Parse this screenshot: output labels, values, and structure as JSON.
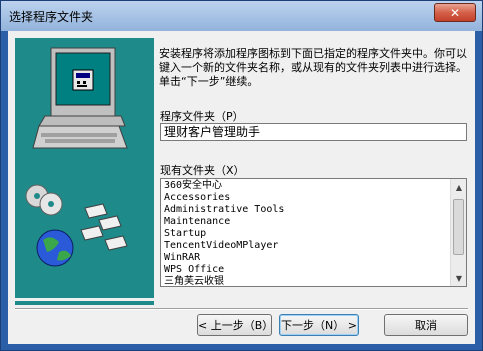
{
  "window": {
    "title": "选择程序文件夹",
    "close_label": "✕"
  },
  "instructions": "安装程序将添加程序图标到下面已指定的程序文件夹中。你可以键入一个新的文件夹名称，或从现有的文件夹列表中进行选择。单击“下一步”继续。",
  "program_folder": {
    "label": "程序文件夹（P）",
    "value": "理财客户管理助手"
  },
  "existing_folders": {
    "label": "现有文件夹（X）",
    "items": [
      "360安全中心",
      "Accessories",
      "Administrative Tools",
      "Maintenance",
      "Startup",
      "TencentVideoMPlayer",
      "WinRAR",
      "WPS Office",
      "三角芙云收银"
    ]
  },
  "buttons": {
    "back": "< 上一步（B）",
    "next": "下一步（N） >",
    "cancel": "取消"
  },
  "colors": {
    "side_panel": "#1f8a8a",
    "frame": "#2a5fa8",
    "close": "#c2412a"
  }
}
